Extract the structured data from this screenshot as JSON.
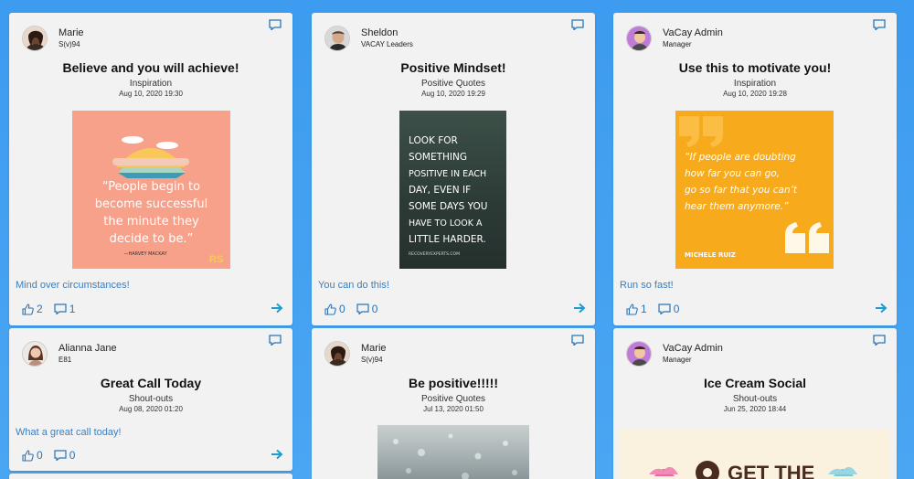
{
  "cards": [
    {
      "author_name": "Marie",
      "author_role": "S(v)94",
      "title": "Believe and you will achieve!",
      "category": "Inspiration",
      "timestamp": "Aug 10, 2020 19:30",
      "image_lines": [
        "“People begin to",
        "become successful",
        "the minute they",
        "decide to be.”"
      ],
      "image_attribution": "—HARVEY MACKAY",
      "image_logo": "RS",
      "caption": "Mind over circumstances!",
      "likes": "2",
      "comments": "1"
    },
    {
      "author_name": "Sheldon",
      "author_role": "VACAY Leaders",
      "title": "Positive Mindset!",
      "category": "Positive Quotes",
      "timestamp": "Aug 10, 2020 19:29",
      "image_lines": [
        "LOOK FOR",
        "SOMETHING",
        "POSITIVE IN EACH",
        "DAY, EVEN IF",
        "SOME DAYS YOU",
        "HAVE TO LOOK A",
        "LITTLE HARDER."
      ],
      "image_attribution": "RECOVERYEXPERTS.COM",
      "caption": "You can do this!",
      "likes": "0",
      "comments": "0"
    },
    {
      "author_name": "VaCay Admin",
      "author_role": "Manager",
      "title": "Use this to motivate you!",
      "category": "Inspiration",
      "timestamp": "Aug 10, 2020 19:28",
      "image_lines": [
        "“If people are doubting",
        "how far you can go,",
        "go so far that you can’t",
        "hear them anymore.”"
      ],
      "image_attribution": "MICHELE RUIZ",
      "caption": "Run so fast!",
      "likes": "1",
      "comments": "0"
    },
    {
      "author_name": "Alianna Jane",
      "author_role": "E81",
      "title": "Great Call Today",
      "category": "Shout-outs",
      "timestamp": "Aug 08, 2020 01:20",
      "caption": "What a great call today!",
      "likes": "0",
      "comments": "0"
    },
    {
      "author_name": "Marie",
      "author_role": "S(v)94",
      "title": "Be positive!!!!!",
      "category": "Positive Quotes",
      "timestamp": "Jul 13, 2020 01:50"
    },
    {
      "author_name": "VaCay Admin",
      "author_role": "Manager",
      "title": "Ice Cream Social",
      "category": "Shout-outs",
      "timestamp": "Jun 25, 2020 18:44",
      "image_lines": [
        "GET THE"
      ]
    }
  ],
  "colors": {
    "background": "#4aa6f3",
    "card": "#f2f2f2",
    "link": "#3b7fbf",
    "action": "#2a74b8",
    "arrow": "#1e9bd1"
  }
}
